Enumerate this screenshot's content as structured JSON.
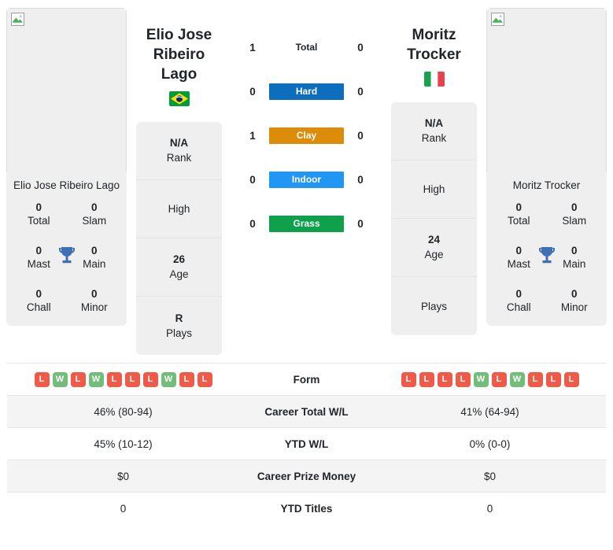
{
  "players": {
    "left": {
      "name": "Elio Jose Ribeiro Lago",
      "name_line1": "Elio Jose",
      "name_line2": "Ribeiro Lago",
      "country": "Brazil",
      "flag_icon": "brazil-flag-icon",
      "photo_status": "broken-image",
      "titles": {
        "total_val": "0",
        "total_lbl": "Total",
        "slam_val": "0",
        "slam_lbl": "Slam",
        "mast_val": "0",
        "mast_lbl": "Mast",
        "main_val": "0",
        "main_lbl": "Main",
        "chall_val": "0",
        "chall_lbl": "Chall",
        "minor_val": "0",
        "minor_lbl": "Minor"
      },
      "info": {
        "rank_val": "N/A",
        "rank_lbl": "Rank",
        "high_val": "",
        "high_lbl": "High",
        "age_val": "26",
        "age_lbl": "Age",
        "plays_val": "R",
        "plays_lbl": "Plays"
      },
      "form": [
        "L",
        "W",
        "L",
        "W",
        "L",
        "L",
        "L",
        "W",
        "L",
        "L"
      ]
    },
    "right": {
      "name": "Moritz Trocker",
      "name_line1": "Moritz",
      "name_line2": "Trocker",
      "country": "Italy",
      "flag_icon": "italy-flag-icon",
      "photo_status": "broken-image",
      "titles": {
        "total_val": "0",
        "total_lbl": "Total",
        "slam_val": "0",
        "slam_lbl": "Slam",
        "mast_val": "0",
        "mast_lbl": "Mast",
        "main_val": "0",
        "main_lbl": "Main",
        "chall_val": "0",
        "chall_lbl": "Chall",
        "minor_val": "0",
        "minor_lbl": "Minor"
      },
      "info": {
        "rank_val": "N/A",
        "rank_lbl": "Rank",
        "high_val": "",
        "high_lbl": "High",
        "age_val": "24",
        "age_lbl": "Age",
        "plays_val": "",
        "plays_lbl": "Plays"
      },
      "form": [
        "L",
        "L",
        "L",
        "L",
        "W",
        "L",
        "W",
        "L",
        "L",
        "L"
      ]
    }
  },
  "surfaces": [
    {
      "label": "Total",
      "left": "1",
      "right": "0",
      "color": "",
      "style": "plain"
    },
    {
      "label": "Hard",
      "left": "0",
      "right": "0",
      "color": "#0d6ebd",
      "style": "pill"
    },
    {
      "label": "Clay",
      "left": "1",
      "right": "0",
      "color": "#dc8c08",
      "style": "pill"
    },
    {
      "label": "Indoor",
      "left": "0",
      "right": "0",
      "color": "#2196f3",
      "style": "pill"
    },
    {
      "label": "Grass",
      "left": "0",
      "right": "0",
      "color": "#0ca14a",
      "style": "pill"
    }
  ],
  "comparison_rows": [
    {
      "label": "Form",
      "left": "",
      "right": "",
      "kind": "form"
    },
    {
      "label": "Career Total W/L",
      "left": "46% (80-94)",
      "right": "41% (64-94)",
      "kind": "text"
    },
    {
      "label": "YTD W/L",
      "left": "45% (10-12)",
      "right": "0% (0-0)",
      "kind": "text"
    },
    {
      "label": "Career Prize Money",
      "left": "$0",
      "right": "$0",
      "kind": "text"
    },
    {
      "label": "YTD Titles",
      "left": "0",
      "right": "0",
      "kind": "text"
    }
  ],
  "colors": {
    "card_bg": "#efefef",
    "win_badge": "#72bd7c",
    "loss_badge": "#ef5b48",
    "table_stripe": "#f4f4f4"
  }
}
